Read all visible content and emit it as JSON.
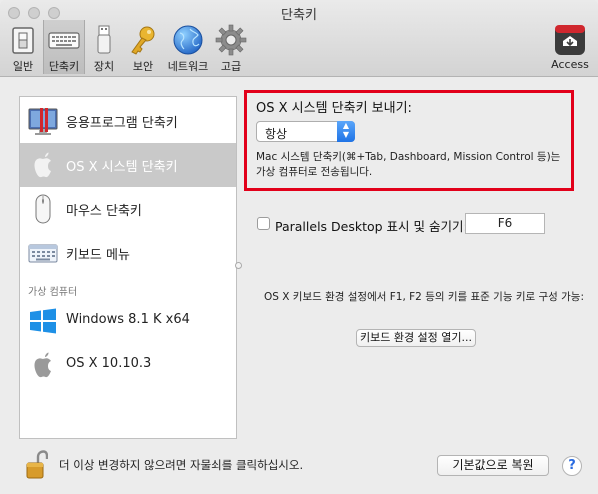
{
  "window": {
    "title": "단축키"
  },
  "toolbar": {
    "items": [
      {
        "label": "일반",
        "icon": "switch-icon"
      },
      {
        "label": "단축키",
        "icon": "keyboard-icon",
        "selected": true
      },
      {
        "label": "장치",
        "icon": "usb-icon"
      },
      {
        "label": "보안",
        "icon": "key-icon"
      },
      {
        "label": "네트워크",
        "icon": "globe-icon"
      },
      {
        "label": "고급",
        "icon": "gear-icon"
      }
    ],
    "access": {
      "label": "Access",
      "badge": "Parallels",
      "icon": "parallels-access-icon"
    }
  },
  "sidebar": {
    "items": [
      {
        "label": "응용프로그램 단축키",
        "icon": "parallels-app-icon"
      },
      {
        "label": "OS X 시스템 단축키",
        "icon": "apple-icon",
        "selected": true
      },
      {
        "label": "마우스 단축키",
        "icon": "mouse-icon"
      },
      {
        "label": "키보드 메뉴",
        "icon": "keyboard-icon"
      }
    ],
    "section_label": "가상 컴퓨터",
    "vms": [
      {
        "label": "Windows 8.1 K x64",
        "icon": "windows-icon"
      },
      {
        "label": "OS X 10.10.3",
        "icon": "apple-icon"
      }
    ]
  },
  "main": {
    "send_shortcuts_label": "OS X 시스템 단축키 보내기:",
    "send_shortcuts_value": "항상",
    "send_shortcuts_desc_line1": "Mac 시스템 단축키(⌘+Tab, Dashboard, Mission Control 등)는",
    "send_shortcuts_desc_line2": "가상 컴퓨터로 전송됩니다.",
    "show_hide_label": "Parallels Desktop 표시 및 숨기기:",
    "show_hide_shortcut": "F6",
    "fn_keys_note": "OS X 키보드 환경 설정에서 F1, F2 등의 키를 표준 기능 키로 구성 가능:",
    "open_keyboard_prefs_button": "키보드 환경 설정 열기..."
  },
  "footer": {
    "lock_text": "더 이상 변경하지 않으려면 자물쇠를 클릭하십시오.",
    "restore_defaults_button": "기본값으로 복원",
    "help_button": "?"
  }
}
